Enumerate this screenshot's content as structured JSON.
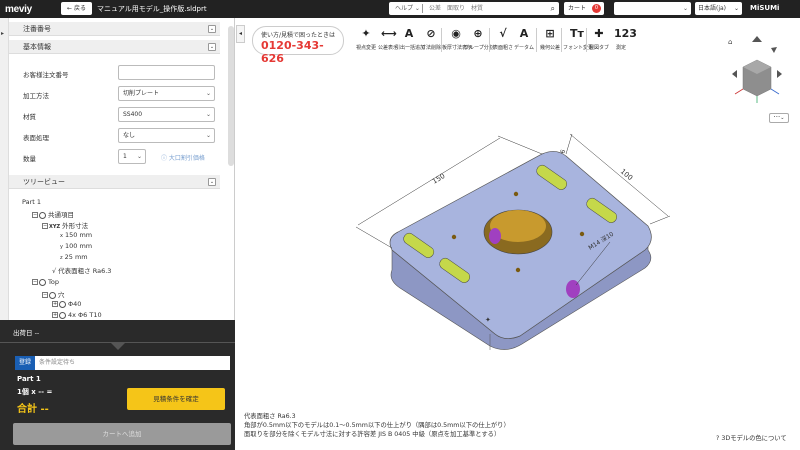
{
  "topbar": {
    "logo": "meviy",
    "back_label": "← 戻る",
    "filename": "マニュアル用モデル_操作版.sldprt",
    "help_label": "ヘルプ ⌄",
    "search_keywords": "公差　面取り　材質",
    "cart_label": "カート",
    "cart_count": "0",
    "language": "日本語(ja)",
    "brand": "MiSUMi"
  },
  "sidebar": {
    "section_notes": "注番番号",
    "section_basic": "基本情報",
    "fields": [
      {
        "label": "お客様注文番号",
        "value": ""
      },
      {
        "label": "加工方法",
        "value": "切削プレート"
      },
      {
        "label": "材質",
        "value": "SS400"
      },
      {
        "label": "表面処理",
        "value": "なし"
      },
      {
        "label": "数量",
        "value": "1"
      }
    ],
    "bulk_link": "大口割引価格",
    "section_tree": "ツリービュー",
    "tree": {
      "part": "Part 1",
      "common": "共通項目",
      "dims_label": "外形寸法",
      "dim_x": "150 mm",
      "dim_y": "100 mm",
      "dim_z": "25 mm",
      "roughness": "代表面粗さ Ra6.3",
      "top": "Top",
      "hole": "穴",
      "phi40": "Φ40",
      "phi6": "4x Φ6 T10"
    }
  },
  "order": {
    "ship_date": "出荷日 --",
    "register_label": "登録",
    "register_placeholder": "条件設定待ち",
    "part_name": "Part 1",
    "qty_line": "1個 x -- =",
    "total": "合計 --",
    "confirm_label": "見積条件を確定",
    "add_cart_label": "カートへ追加"
  },
  "viewer": {
    "phone_line1": "使い方/見積で困ったときは",
    "phone_number": "0120-343-626",
    "tools": [
      {
        "icon": "✦",
        "label": "視点変更"
      },
      {
        "icon": "⟷",
        "label": "公差表示"
      },
      {
        "icon": "A",
        "label": "引出一括追加"
      },
      {
        "icon": "⊘",
        "label": "寸法削除"
      },
      {
        "icon": "◉",
        "label": "板厚寸法表示"
      },
      {
        "icon": "⊕",
        "label": "グループ分割"
      },
      {
        "icon": "√",
        "label": "表面粗さ"
      },
      {
        "icon": "A",
        "label": "データム"
      },
      {
        "icon": "⊞",
        "label": "幾何公差"
      },
      {
        "icon": "Tт",
        "label": "フォント変更"
      },
      {
        "icon": "✚",
        "label": "製図タブ"
      },
      {
        "icon": "123",
        "label": "測定"
      }
    ],
    "dims": {
      "d150": "150",
      "d100": "100",
      "m14": "M14 深10",
      "d6": "6"
    },
    "notes": [
      "代表面粗さ Ra6.3",
      "角部が0.5mm以下のモデルは0.1〜0.5mm以下の仕上がり（隅部は0.5mm以下の仕上がり）",
      "面取りを部分を除くモデル寸法に対する許容差 JIS B 0405 中級（原点を加工基準とする）"
    ],
    "about_link": "3Dモデルの色について"
  },
  "colors": {
    "plate": "#a8b4de",
    "plate_side": "#9aa6d0",
    "pocket": "#c5d84a",
    "bore": "#c89a2e",
    "hole_purple": "#a040c0",
    "phone_red": "#e53935",
    "confirm_yellow": "#f5c518",
    "register_blue": "#1a5fb4"
  }
}
